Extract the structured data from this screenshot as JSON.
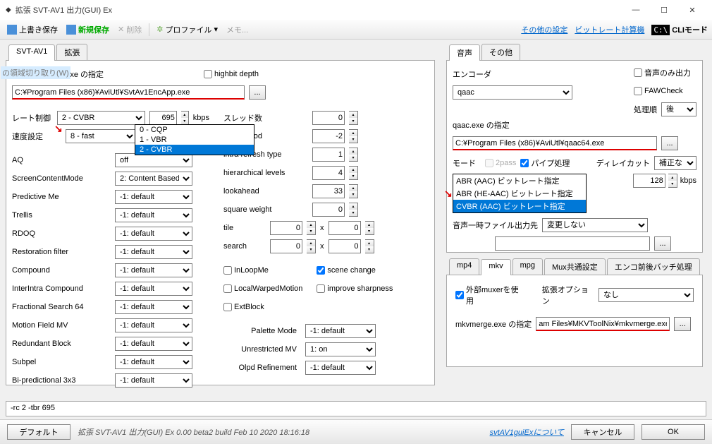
{
  "window": {
    "title": "拡張 SVT-AV1 出力(GUI) Ex"
  },
  "toolbar": {
    "save": "上書き保存",
    "newsave": "新規保存",
    "delete": "削除",
    "profile": "プロファイル",
    "memo": "メモ...",
    "other_settings": "その他の設定",
    "bitrate_calc": "ビットレート計算機",
    "cli_mode": "CLIモード"
  },
  "video_tabs": [
    "SVT-AV1",
    "拡張"
  ],
  "video": {
    "exe_label": "SvtAv1EncApp.exe の指定",
    "highbit": "highbit depth",
    "exe_path": "C:¥Program Files (x86)¥AviUtl¥SvtAv1EncApp.exe",
    "browse": "...",
    "region_hint": "の領域切り取り(W)",
    "rate_label": "レート制御",
    "rate_value": "2 - CVBR",
    "rate_options": [
      "0 - CQP",
      "1 - VBR",
      "2 - CVBR"
    ],
    "bitrate": "695",
    "kbps": "kbps",
    "speed_label": "速度設定",
    "speed_value": "8 - fast",
    "params": {
      "aq_l": "AQ",
      "aq_v": "off",
      "scm_l": "ScreenContentMode",
      "scm_v": "2: Content Based",
      "pme_l": "Predictive Me",
      "pme_v": "-1: default",
      "trl_l": "Trellis",
      "trl_v": "-1: default",
      "rdo_l": "RDOQ",
      "rdo_v": "-1: default",
      "rst_l": "Restoration filter",
      "rst_v": "-1: default",
      "cmp_l": "Compound",
      "cmp_v": "-1: default",
      "iic_l": "InterIntra Compound",
      "iic_v": "-1: default",
      "fs_l": "Fractional Search 64",
      "fs_v": "-1: default",
      "mfm_l": "Motion Field MV",
      "mfm_v": "-1: default",
      "rdb_l": "Redundant Block",
      "rdb_v": "-1: default",
      "sub_l": "Subpel",
      "sub_v": "-1: default",
      "bip_l": "Bi-predictional 3x3",
      "bip_v": "-1: default"
    },
    "right": {
      "threads_l": "スレッド数",
      "threads_v": "0",
      "intra_l": "intra period",
      "intra_v": "-2",
      "irtf_l": "intra refresh type",
      "irtf_v": "1",
      "hier_l": "hierarchical levels",
      "hier_v": "4",
      "look_l": "lookahead",
      "look_v": "33",
      "sqw_l": "square weight",
      "sqw_v": "0",
      "tile_l": "tile",
      "tile_x": "0",
      "tile_y": "0",
      "srch_l": "search",
      "srch_x": "0",
      "srch_y": "0",
      "inloop": "InLoopMe",
      "localwarp": "LocalWarpedMotion",
      "extblock": "ExtBlock",
      "scene": "scene change",
      "sharp": "improve sharpness",
      "palette_l": "Palette Mode",
      "palette_v": "-1: default",
      "unres_l": "Unrestricted MV",
      "unres_v": "1: on",
      "olpd_l": "Olpd Refinement",
      "olpd_v": "-1: default"
    }
  },
  "audio_tabs": [
    "音声",
    "その他"
  ],
  "audio": {
    "encoder_l": "エンコーダ",
    "encoder_v": "qaac",
    "audio_only": "音声のみ出力",
    "faw": "FAWCheck",
    "order_l": "処理順",
    "order_v": "後",
    "exe_l": "qaac.exe の指定",
    "exe_path": "C:¥Program Files (x86)¥AviUtl¥qaac64.exe",
    "mode_l": "モード",
    "twopass": "2pass",
    "pipe": "パイプ処理",
    "delay_l": "ディレイカット",
    "delay_v": "補正なし",
    "modes": [
      "ABR (AAC) ビットレート指定",
      "ABR (HE-AAC) ビットレート指定",
      "CVBR (AAC) ビットレート指定"
    ],
    "bitrate": "128",
    "kbps": "kbps",
    "temp_l": "音声一時ファイル出力先",
    "temp_v": "変更しない"
  },
  "mux_tabs": [
    "mp4",
    "mkv",
    "mpg",
    "Mux共通設定",
    "エンコ前後バッチ処理"
  ],
  "mux": {
    "ext_muxer": "外部muxerを使用",
    "extopt_l": "拡張オプション",
    "extopt_v": "なし",
    "exe_l": "mkvmerge.exe の指定",
    "exe_v": "am Files¥MKVToolNix¥mkvmerge.exe"
  },
  "cmdline": "-rc 2 -tbr 695",
  "bottom": {
    "default": "デフォルト",
    "status": "拡張 SVT-AV1 出力(GUI) Ex 0.00 beta2  build Feb 10 2020 18:16:18",
    "about": "svtAV1guiExについて",
    "cancel": "キャンセル",
    "ok": "OK"
  }
}
